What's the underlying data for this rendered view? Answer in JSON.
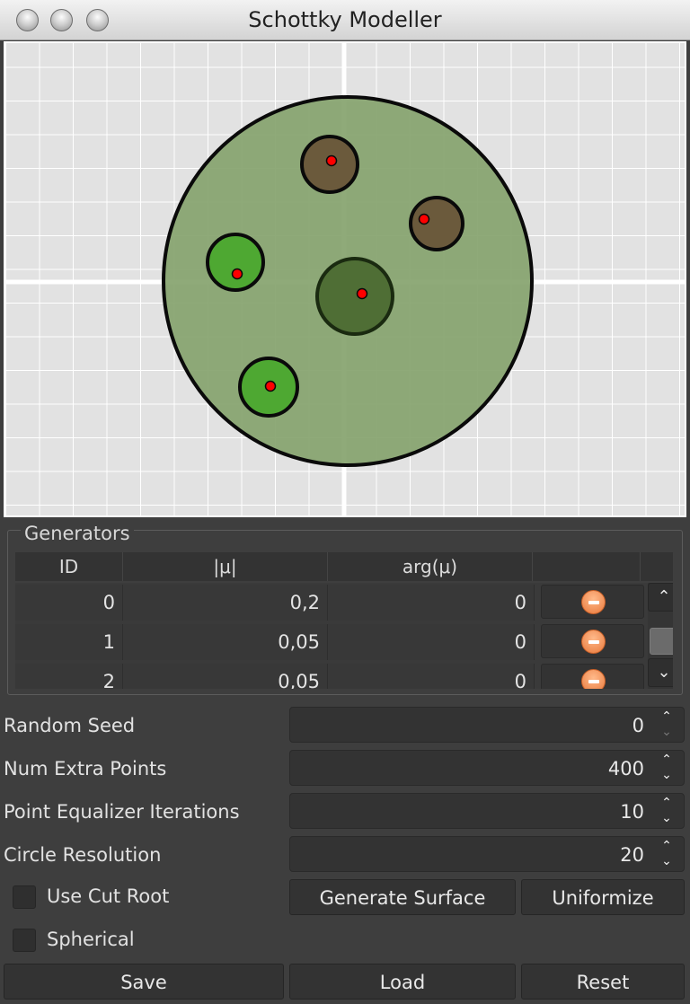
{
  "window": {
    "title": "Schottky Modeller"
  },
  "generators": {
    "title": "Generators",
    "columns": [
      "ID",
      "|μ|",
      "arg(μ)",
      ""
    ],
    "rows": [
      {
        "id": "0",
        "mu_abs": "0,2",
        "mu_arg": "0"
      },
      {
        "id": "1",
        "mu_abs": "0,05",
        "mu_arg": "0"
      },
      {
        "id": "2",
        "mu_abs": "0,05",
        "mu_arg": "0"
      }
    ],
    "scroll_position": 0.33
  },
  "fields": {
    "random_seed": {
      "label": "Random Seed",
      "value": "0"
    },
    "num_extra_points": {
      "label": "Num Extra Points",
      "value": "400"
    },
    "point_equalizer_iterations": {
      "label": "Point Equalizer Iterations",
      "value": "10"
    },
    "circle_resolution": {
      "label": "Circle Resolution",
      "value": "20"
    }
  },
  "checkboxes": {
    "use_cut_root": {
      "label": "Use Cut Root",
      "checked": false
    },
    "spherical": {
      "label": "Spherical",
      "checked": false
    }
  },
  "buttons": {
    "generate_surface": "Generate Surface",
    "uniformize": "Uniformize",
    "save": "Save",
    "load": "Load",
    "reset": "Reset"
  },
  "colors": {
    "outer_disk": "#86a36e",
    "brown_circle": "#6b5a3c",
    "bright_green_circle": "#4ea832",
    "dark_green_circle": "#4f6e35",
    "point": "#ff0000",
    "remove_icon": "#f08a4b"
  },
  "icons": [
    "minus-circle-icon",
    "chevron-up-icon",
    "chevron-down-icon",
    "spin-up-icon",
    "spin-down-icon"
  ]
}
